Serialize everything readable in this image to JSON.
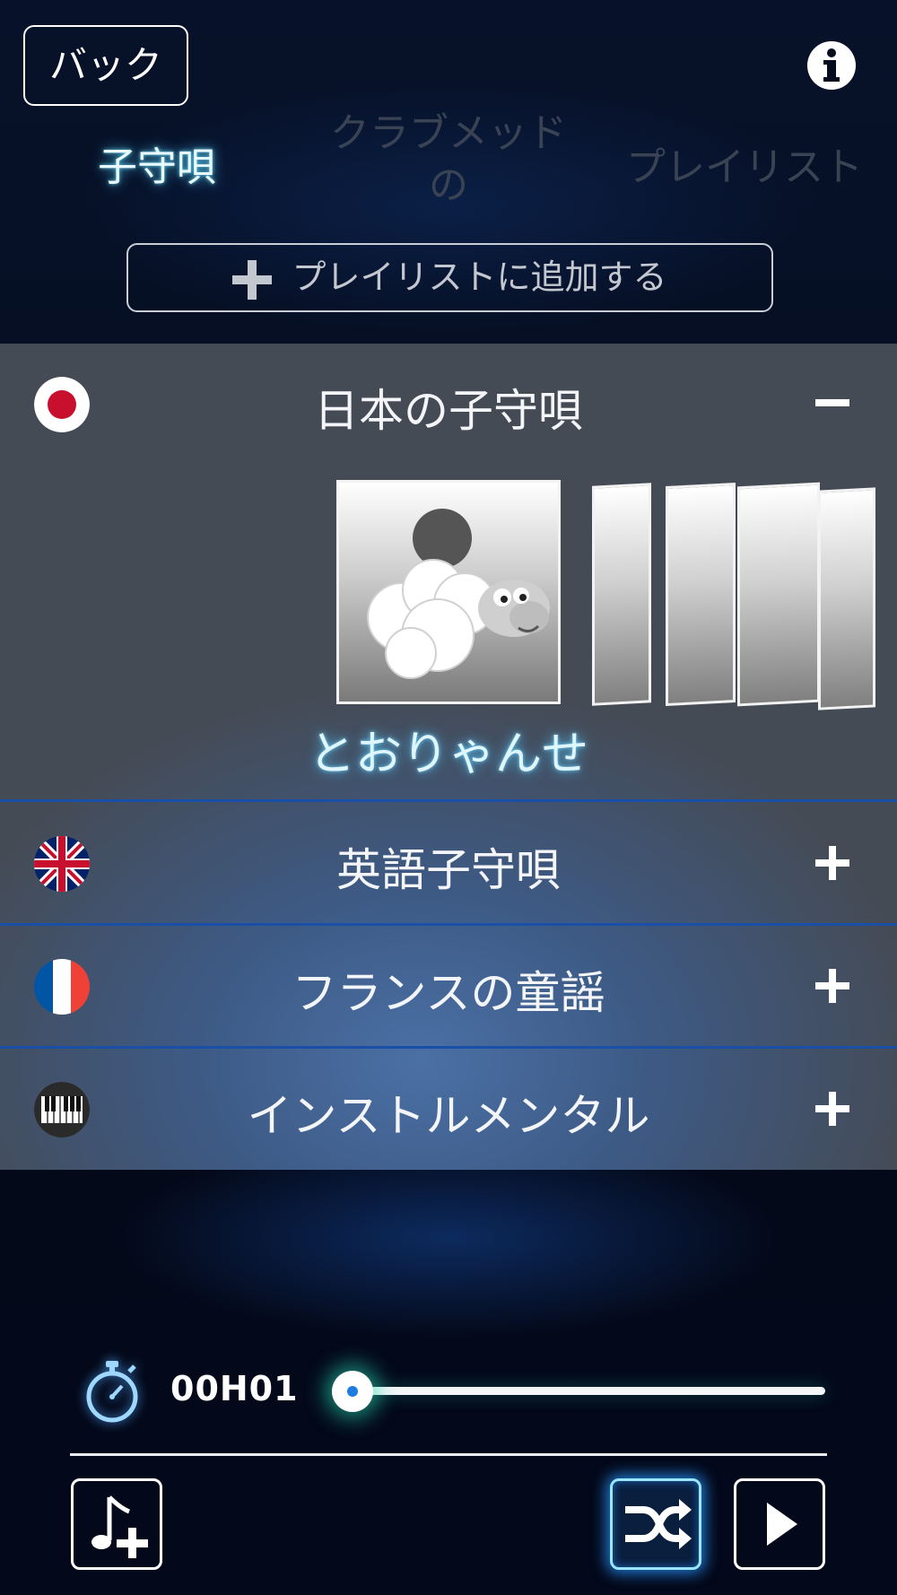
{
  "header": {
    "back_label": "バック",
    "info_icon": "info-icon"
  },
  "tabs": [
    {
      "label": "子守唄",
      "active": true
    },
    {
      "label": "クラブメッド\nの",
      "active": false
    },
    {
      "label": "プレイリスト",
      "active": false
    }
  ],
  "add_playlist": {
    "icon": "plus-icon",
    "label": "プレイリストに追加する"
  },
  "categories": [
    {
      "label": "日本の子守唄",
      "flag": "japan-flag",
      "expanded": true,
      "toggle": "minus"
    },
    {
      "label": "英語子守唄",
      "flag": "uk-flag",
      "expanded": false,
      "toggle": "plus"
    },
    {
      "label": "フランスの童謡",
      "flag": "france-flag",
      "expanded": false,
      "toggle": "plus"
    },
    {
      "label": "インストルメンタル",
      "flag": "piano-icon",
      "expanded": false,
      "toggle": "plus"
    }
  ],
  "carousel": {
    "current_song": "とおりゃんせ",
    "cover_icon": "sheep-moon-icon"
  },
  "timer": {
    "icon": "stopwatch-icon",
    "value": "00H01",
    "slider_fraction": 0.0
  },
  "controls": {
    "add_music": "music-add-icon",
    "shuffle": "shuffle-icon",
    "play": "play-icon"
  },
  "colors": {
    "active_tab_glow": "#50d2ff",
    "inactive_tab": "#3a4354",
    "divider": "#1a4fa8",
    "slider_glow": "#28dcb4"
  }
}
